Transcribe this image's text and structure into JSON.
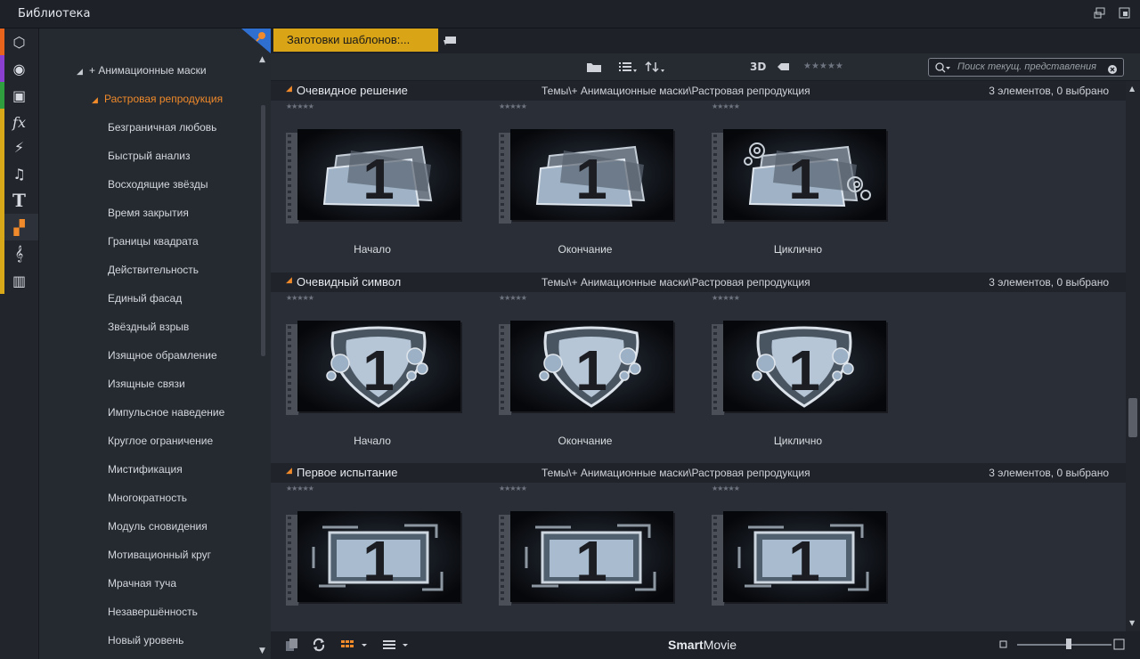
{
  "window": {
    "title": "Библиотека"
  },
  "sidebar_icons": [
    {
      "name": "archive-icon",
      "glyph": "⬡",
      "stripe": "#e8641c"
    },
    {
      "name": "film-reel-icon",
      "glyph": "◉",
      "stripe": "#8a3fd1"
    },
    {
      "name": "photos-icon",
      "glyph": "▣",
      "stripe": "#2e9e3e"
    },
    {
      "name": "fx-icon",
      "glyph": "fx",
      "stripe": "#d8a818"
    },
    {
      "name": "lightning-icon",
      "glyph": "⚡",
      "stripe": "#d8a818"
    },
    {
      "name": "music-note-icon",
      "glyph": "♫",
      "stripe": "#d8a818"
    },
    {
      "name": "title-text-icon",
      "glyph": "T",
      "stripe": "#d8a818"
    },
    {
      "name": "templates-icon",
      "glyph": "▞",
      "stripe": "#d8a818"
    },
    {
      "name": "audio-clef-icon",
      "glyph": "𝄞",
      "stripe": "#d8a818"
    },
    {
      "name": "piano-icon",
      "glyph": "▥",
      "stripe": "#d8a818"
    }
  ],
  "tree": {
    "parent": "+ Анимационные маски",
    "selected": "Растровая репродукция",
    "items": [
      "Безграничная любовь",
      "Быстрый анализ",
      "Восходящие звёзды",
      "Время закрытия",
      "Границы квадрата",
      "Действительность",
      "Единый фасад",
      "Звёздный взрыв",
      "Изящное обрамление",
      "Изящные связи",
      "Импульсное наведение",
      "Круглое ограничение",
      "Мистификация",
      "Многократность",
      "Модуль сновидения",
      "Мотивационный круг",
      "Мрачная туча",
      "Незавершённость",
      "Новый уровень"
    ]
  },
  "tab": {
    "label": "Заготовки шаблонов:..."
  },
  "toolbar": {
    "view_3d": "3D",
    "search_placeholder": "Поиск текущ. представления"
  },
  "groups": [
    {
      "name": "Очевидное решение",
      "path": "Темы\\+ Анимационные маски\\Растровая репродукция",
      "count": "3 элементов, 0 выбрано",
      "items": [
        {
          "caption": "Начало",
          "style": "panels"
        },
        {
          "caption": "Окончание",
          "style": "panels"
        },
        {
          "caption": "Циклично",
          "style": "panels-ornate"
        }
      ]
    },
    {
      "name": "Очевидный символ",
      "path": "Темы\\+ Анимационные маски\\Растровая репродукция",
      "count": "3 элементов, 0 выбрано",
      "items": [
        {
          "caption": "Начало",
          "style": "shield"
        },
        {
          "caption": "Окончание",
          "style": "shield"
        },
        {
          "caption": "Циклично",
          "style": "shield"
        }
      ]
    },
    {
      "name": "Первое испытание",
      "path": "Темы\\+ Анимационные маски\\Растровая репродукция",
      "count": "3 элементов, 0 выбрано",
      "items": [
        {
          "caption": "",
          "style": "frame"
        },
        {
          "caption": "",
          "style": "frame"
        },
        {
          "caption": "",
          "style": "frame"
        }
      ]
    }
  ],
  "bottom": {
    "brand_bold": "Smart",
    "brand_rest": "Movie"
  },
  "colors": {
    "accent_orange": "#f08a2a",
    "tab_gold": "#d9a415"
  }
}
